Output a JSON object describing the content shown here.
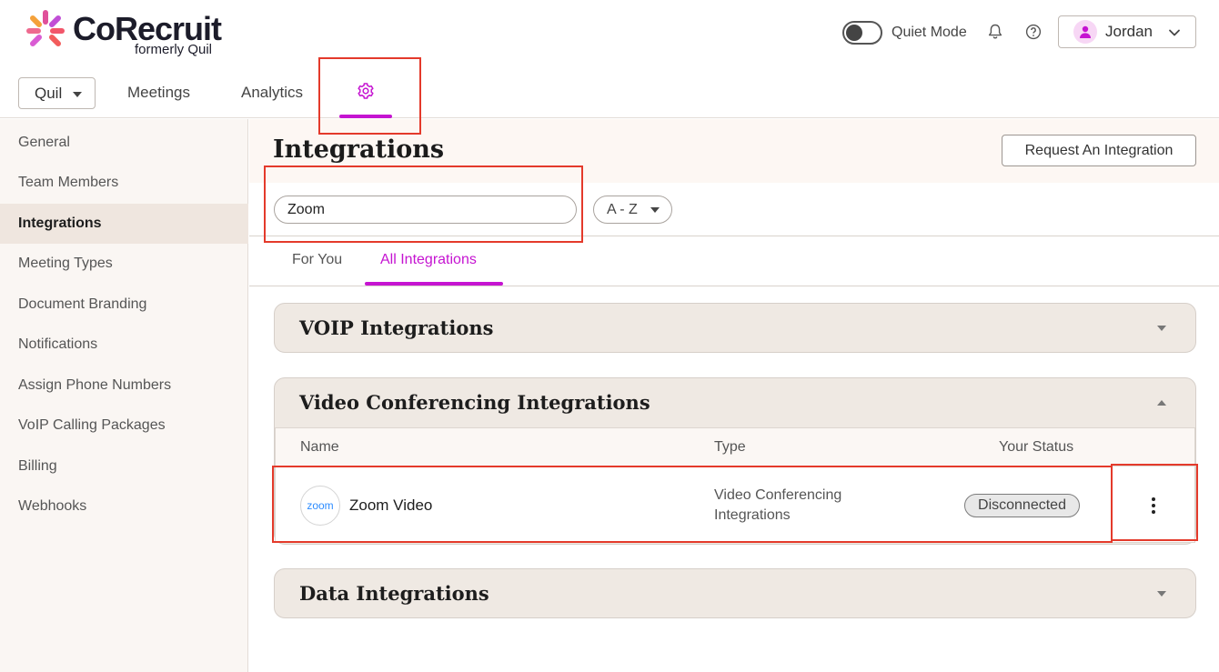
{
  "brand": {
    "name": "CoRecruit",
    "subtitle": "formerly Quil",
    "accent": "#c514d1"
  },
  "header": {
    "quiet_mode_label": "Quiet Mode",
    "quiet_mode_on": false,
    "user_name": "Jordan",
    "icons": [
      "bell-icon",
      "help-icon",
      "chevron-down-icon",
      "user-avatar-icon"
    ]
  },
  "nav": {
    "app_select": "Quil",
    "links": [
      "Meetings",
      "Analytics"
    ],
    "active_tab": "settings-gear-icon"
  },
  "sidebar": {
    "items": [
      {
        "label": "General"
      },
      {
        "label": "Team Members"
      },
      {
        "label": "Integrations"
      },
      {
        "label": "Meeting Types"
      },
      {
        "label": "Document Branding"
      },
      {
        "label": "Notifications"
      },
      {
        "label": "Assign Phone Numbers"
      },
      {
        "label": "VoIP Calling Packages"
      },
      {
        "label": "Billing"
      },
      {
        "label": "Webhooks"
      }
    ],
    "active": "Integrations"
  },
  "main": {
    "title": "Integrations",
    "request_button": "Request An Integration",
    "search_value": "Zoom",
    "sort_value": "A - Z",
    "tabs": [
      {
        "label": "For You"
      },
      {
        "label": "All Integrations"
      }
    ],
    "active_tab": "All Integrations",
    "sections": [
      {
        "title": "VOIP Integrations",
        "expanded": false
      },
      {
        "title": "Video Conferencing Integrations",
        "expanded": true
      },
      {
        "title": "Data Integrations",
        "expanded": false
      }
    ],
    "table": {
      "headers": [
        "Name",
        "Type",
        "Your Status"
      ],
      "rows": [
        {
          "logo_text": "zoom",
          "name": "Zoom Video",
          "type": "Video Conferencing Integrations",
          "status": "Disconnected"
        }
      ]
    }
  }
}
